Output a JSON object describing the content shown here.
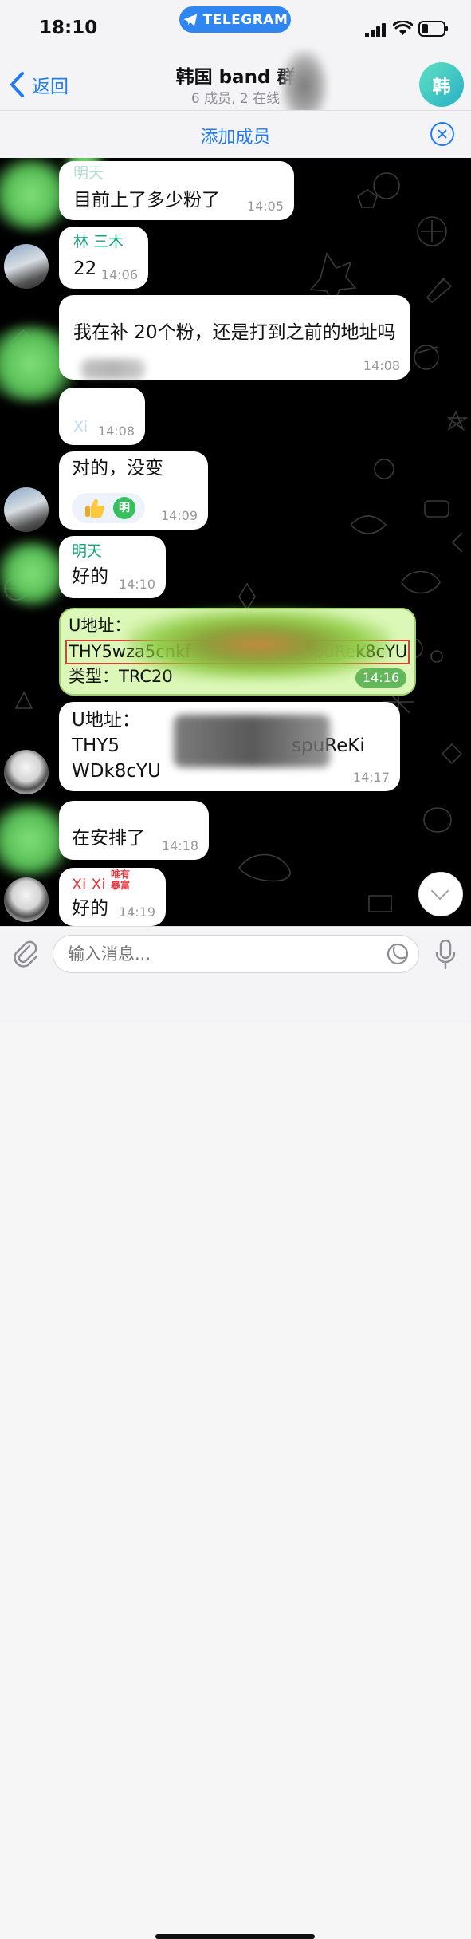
{
  "status_bar": {
    "time": "18:10",
    "app_pill": "TELEGRAM"
  },
  "header": {
    "back": "返回",
    "title": "韩国 band 群",
    "subtitle": "6 成员, 2 在线",
    "avatar_letter": "韩"
  },
  "banner": {
    "add_members": "添加成员"
  },
  "messages": [
    {
      "sender": "明天",
      "text": "目前上了多少粉了",
      "time": "14:05"
    },
    {
      "sender": "林 三木",
      "text": "22",
      "time": "14:06"
    },
    {
      "text": "我在补 20个粉，还是打到之前的地址吗",
      "time": "14:08"
    },
    {
      "text": "Xi",
      "time": "14:08"
    },
    {
      "text": "对的，没变",
      "time": "14:09",
      "reaction_avatar": "明"
    },
    {
      "sender": "明天",
      "text": "好的",
      "time": "14:10"
    },
    {
      "line1": "U地址：",
      "line2": "THY5wza5cnkf",
      "line2_tail": "spuReKi",
      "line2_end": "k8cYU",
      "line3": "类型：TRC20",
      "time": "14:16"
    },
    {
      "line1": "U地址：",
      "line2": "THY5",
      "line2_tail": "spuReKi",
      "line3": "WDk8cYU",
      "time": "14:17"
    },
    {
      "text": "在安排了",
      "time": "14:18"
    },
    {
      "sender": "Xi Xi",
      "badge_line1": "唯有",
      "badge_line2": "暴富",
      "text": "好的",
      "time": "14:19"
    }
  ],
  "composer": {
    "placeholder": "输入消息..."
  },
  "icons": {
    "accent": "#1f7cf2",
    "green": "#19a37a",
    "red": "#e0383e"
  }
}
